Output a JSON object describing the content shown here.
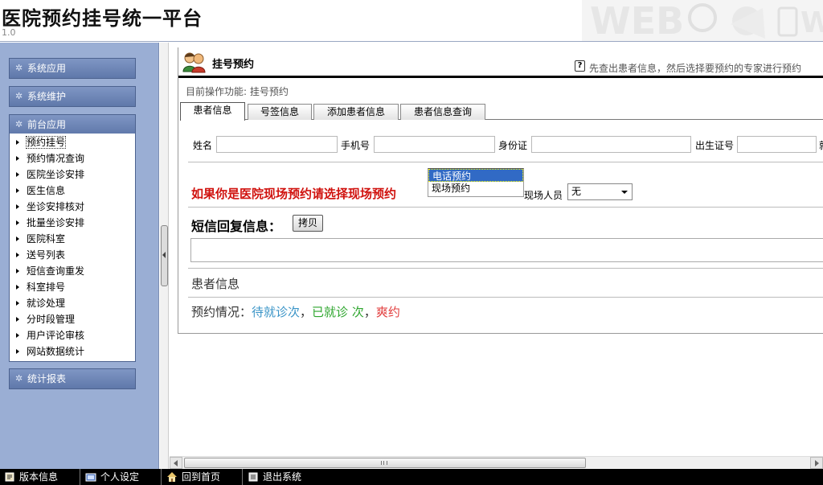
{
  "header": {
    "title": "医院预约挂号统一平台",
    "version": "1.0"
  },
  "sidebar": {
    "groups": [
      {
        "label": "系统应用"
      },
      {
        "label": "系统维护"
      },
      {
        "label": "前台应用"
      },
      {
        "label": "统计报表"
      }
    ],
    "front_items": [
      {
        "label": "预约挂号"
      },
      {
        "label": "预约情况查询"
      },
      {
        "label": "医院坐诊安排"
      },
      {
        "label": "医生信息"
      },
      {
        "label": "坐诊安排核对"
      },
      {
        "label": "批量坐诊安排"
      },
      {
        "label": "医院科室"
      },
      {
        "label": "送号列表"
      },
      {
        "label": "短信查询重发"
      },
      {
        "label": "科室排号"
      },
      {
        "label": "就诊处理"
      },
      {
        "label": "分时段管理"
      },
      {
        "label": "用户评论审核"
      },
      {
        "label": "网站数据统计"
      }
    ]
  },
  "main": {
    "title": "挂号预约",
    "help_text": "先查出患者信息，然后选择要预约的专家进行预约",
    "current_function": "目前操作功能: 挂号预约",
    "tabs": [
      {
        "label": "患者信息"
      },
      {
        "label": "号签信息"
      },
      {
        "label": "添加患者信息"
      },
      {
        "label": "患者信息查询"
      }
    ],
    "form": {
      "name_label": "姓名",
      "phone_label": "手机号",
      "id_label": "身份证",
      "birth_cert_label": "出生证号",
      "cut_label": "就"
    },
    "onsite_tip": "如果你是医院现场预约请选择现场预约",
    "booking_types": [
      "电话预约",
      "现场预约"
    ],
    "onsite_staff_label": "现场人员",
    "onsite_staff_value": "无",
    "sms_title": "短信回复信息：",
    "copy_button": "拷贝",
    "patient_info": "患者信息",
    "booking_status": {
      "prefix": "预约情况：",
      "pending": "待就诊次",
      "sep1": "，",
      "done": "已就诊  次",
      "sep2": "，",
      "missed": "爽约"
    }
  },
  "taskbar": [
    {
      "label": "版本信息",
      "icon": "version-info-icon"
    },
    {
      "label": "个人设定",
      "icon": "personal-settings-icon"
    },
    {
      "label": "回到首页",
      "icon": "home-icon"
    },
    {
      "label": "退出系统",
      "icon": "logout-icon"
    }
  ],
  "colors": {
    "tip_red": "#d0120e",
    "pending_blue": "#3a94c7",
    "done_green": "#2ea62e",
    "missed_red": "#e23d3d",
    "sidebar_bg": "#9aaed4"
  }
}
